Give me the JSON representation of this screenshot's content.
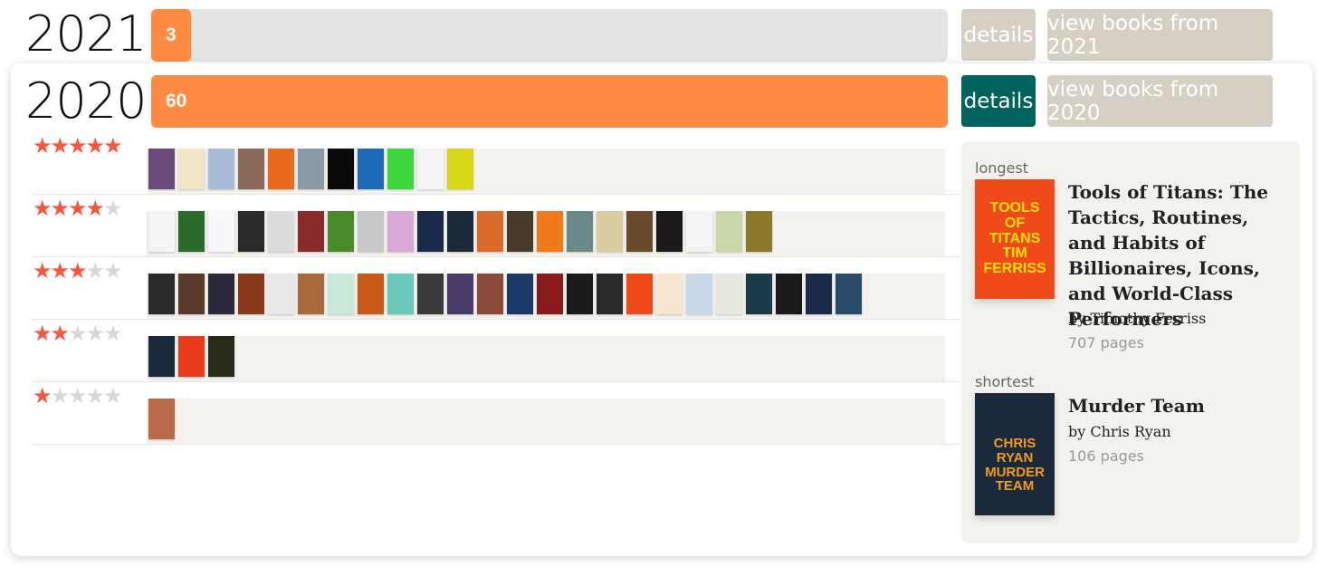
{
  "years": [
    {
      "year": "2021",
      "count": "3",
      "progress": 0.05,
      "details_label": "details",
      "view_label": "view books from 2021"
    },
    {
      "year": "2020",
      "count": "60",
      "progress": 1.0,
      "details_label": "details",
      "view_label": "view books from 2020"
    }
  ],
  "colors": {
    "accent": "#ff8a42",
    "bar_bg": "#e4e4e4",
    "button_muted": "#d6d0c4",
    "button_active": "#00635d",
    "star_on": "#f5573f",
    "star_off": "#d8d8d8"
  },
  "ratings": [
    {
      "stars": 5,
      "covers": [
        "#6a4a7a",
        "#f2e6c8",
        "#a8bcd8",
        "#8a6a5a",
        "#e86a1a",
        "#8a9aa6",
        "#0a0a0a",
        "#1a6ab8",
        "#3ad83a",
        "#f4f4f4",
        "#d8d818"
      ]
    },
    {
      "stars": 4,
      "covers": [
        "#f4f4f4",
        "#2a6a2a",
        "#f8f8f8",
        "#2a2a2a",
        "#dcdcdc",
        "#8a2a2a",
        "#4a8a2a",
        "#c8c8c8",
        "#d8a8d8",
        "#1a2a4a",
        "#1a2a3a",
        "#d86a2a",
        "#4a3a2a",
        "#f07a1a",
        "#6a8a8a",
        "#d8cca0",
        "#6a4a2a",
        "#1a1a1a",
        "#f4f4f4",
        "#c8d8a8",
        "#8a7a2a"
      ]
    },
    {
      "stars": 3,
      "covers": [
        "#2a2a2a",
        "#5a3a2a",
        "#2a2a3a",
        "#8a3a1a",
        "#e8e8e8",
        "#a86a3a",
        "#c8e8d8",
        "#c85a1a",
        "#6ac8b8",
        "#3a3a3a",
        "#4a3a6a",
        "#8a4a3a",
        "#1a3a6a",
        "#8a1a1a",
        "#1a1a1a",
        "#2a2a2a",
        "#f04a1a",
        "#f4e8d0",
        "#c8d8e8",
        "#e8e8e0",
        "#1a3a4a",
        "#1a1a1a",
        "#1a2a4a",
        "#2a4a6a"
      ]
    },
    {
      "stars": 2,
      "covers": [
        "#1a2a3a",
        "#e83a1a",
        "#2a2a1a"
      ]
    },
    {
      "stars": 1,
      "covers": [
        "#b86a4a"
      ]
    }
  ],
  "longest": {
    "label": "longest",
    "title": "Tools of Titans: The Tactics, Routines, and Habits of Billionaires, Icons, and World-Class Performers",
    "author": "by Timothy Ferriss",
    "pages": "707 pages",
    "cover_color": "#f04a1a",
    "cover_text": "TOOLS OF TITANS TIM FERRISS"
  },
  "shortest": {
    "label": "shortest",
    "title": "Murder Team",
    "author": "by Chris Ryan",
    "pages": "106 pages",
    "cover_color": "#1a2a3a",
    "cover_text": "CHRIS RYAN MURDER TEAM"
  }
}
